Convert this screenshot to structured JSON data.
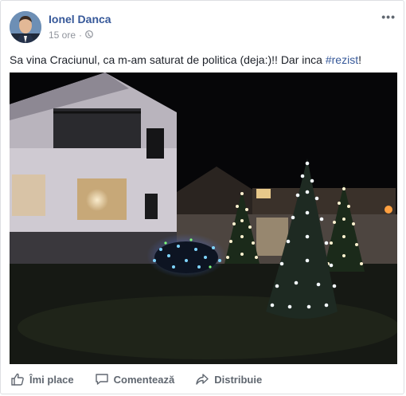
{
  "post": {
    "author": "Ionel Danca",
    "time": "15 ore",
    "separator": "·",
    "text_prefix": "Sa vina Craciunul, ca m-am saturat de politica (deja:)!! Dar inca ",
    "hashtag": "#rezist",
    "text_suffix": "!",
    "more_icon": "more-options-icon",
    "privacy_icon": "globe-icon"
  },
  "actions": {
    "like": "Îmi place",
    "comment": "Comentează",
    "share": "Distribuie"
  },
  "colors": {
    "link": "#365899",
    "meta": "#90949c",
    "action": "#606770"
  }
}
